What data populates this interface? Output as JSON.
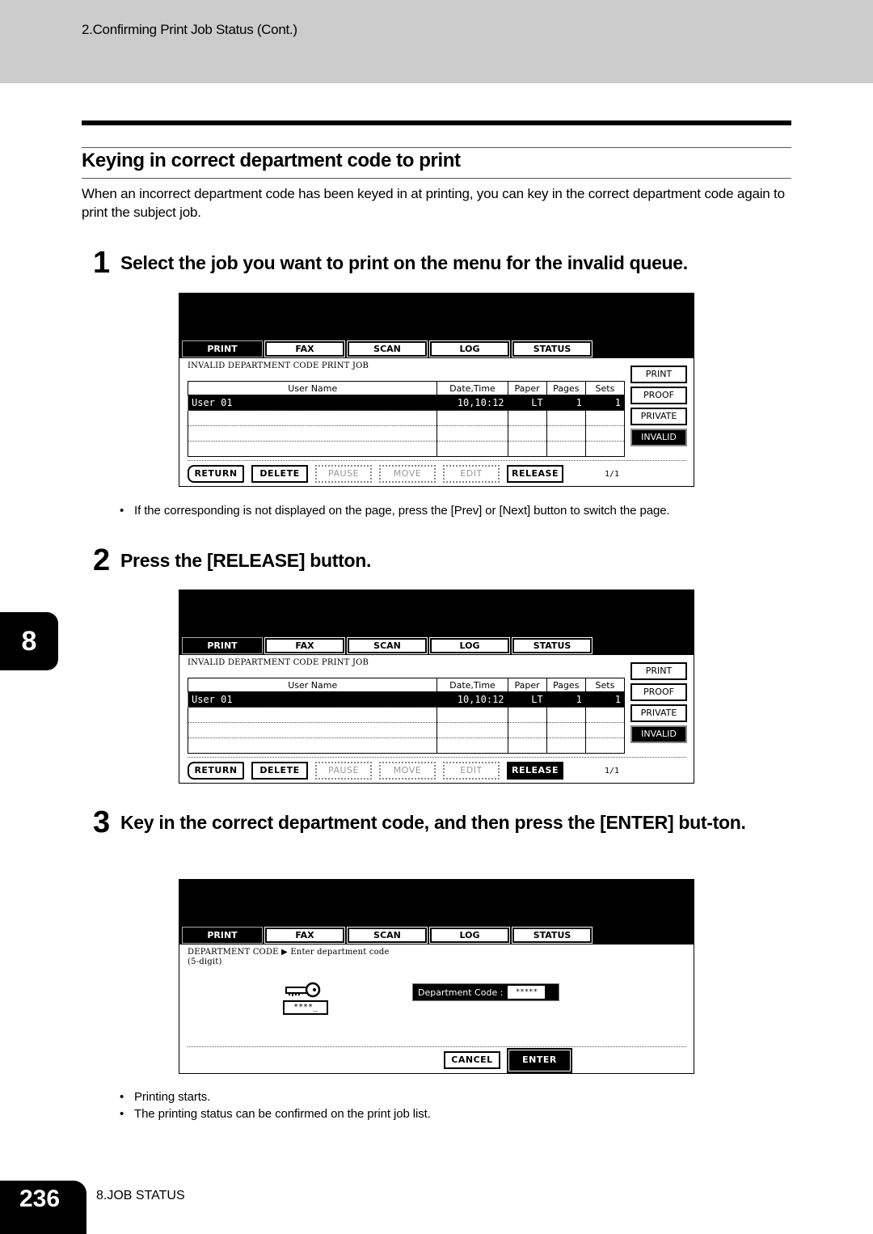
{
  "header": {
    "breadcrumb": "2.Confirming Print Job Status (Cont.)"
  },
  "section": {
    "title": "Keying in correct department code to print",
    "intro": "When an incorrect department code has been keyed in at printing, you can key in the correct department code again to print the subject job."
  },
  "steps": [
    {
      "number": "1",
      "text": "Select the job you want to print on the menu for the invalid queue.",
      "notes": [
        "If the corresponding is not displayed on the page, press the [Prev] or [Next] button to switch the page."
      ]
    },
    {
      "number": "2",
      "text": "Press the [RELEASE] button.",
      "notes": []
    },
    {
      "number": "3",
      "text": "Key in the correct department code, and then press the [ENTER] but-ton.",
      "notes": [
        "Printing starts.",
        "The printing status can be confirmed on the print job list."
      ]
    }
  ],
  "panel_tabs": [
    "PRINT",
    "FAX",
    "SCAN",
    "LOG",
    "STATUS"
  ],
  "job_screen": {
    "caption": "INVALID DEPARTMENT CODE PRINT JOB",
    "columns": [
      "User Name",
      "Date,Time",
      "Paper",
      "Pages",
      "Sets"
    ],
    "rows": [
      {
        "user": "User 01",
        "datetime": "10,10:12",
        "paper": "LT",
        "pages": "1",
        "sets": "1"
      }
    ],
    "side_buttons": [
      "PRINT",
      "PROOF",
      "PRIVATE",
      "INVALID"
    ],
    "bottom_buttons": [
      "RETURN",
      "DELETE",
      "PAUSE",
      "MOVE",
      "EDIT",
      "RELEASE"
    ],
    "pager": "1/1"
  },
  "dept_screen": {
    "caption_line1": "DEPARTMENT CODE ▶ Enter department code",
    "caption_line2": "(5-digit)",
    "key_field": "****_",
    "dept_label": "Department Code  :",
    "dept_value": "*****",
    "cancel": "CANCEL",
    "enter": "ENTER"
  },
  "chapter_tab": "8",
  "footer": {
    "page_number": "236",
    "chapter_label": "8.JOB STATUS"
  }
}
